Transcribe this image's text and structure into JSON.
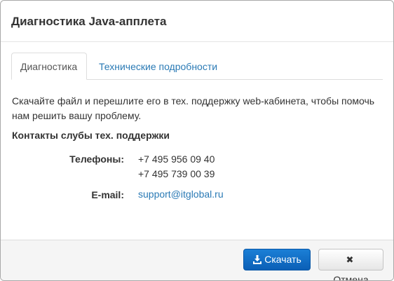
{
  "modal": {
    "title": "Диагностика Java-апплета"
  },
  "tabs": [
    {
      "label": "Диагностика",
      "active": true
    },
    {
      "label": "Технические подробности",
      "active": false
    }
  ],
  "body": {
    "intro": "Скачайте файл и перешлите его в тех. поддержку web-кабинета, чтобы помочь нам решить вашу проблему.",
    "contacts_heading": "Контакты слубы тех. поддержки",
    "phones_label": "Телефоны:",
    "phones": [
      "+7 495 956 09 40",
      "+7 495 739 00 39"
    ],
    "email_label": "E-mail:",
    "email": "support@itglobal.ru"
  },
  "footer": {
    "download_label": "Скачать",
    "download_icon": "download-icon",
    "cancel_label": "Отмена",
    "cancel_icon": "close-icon"
  },
  "colors": {
    "primary": "#0b6ec4",
    "link": "#2a7ab5",
    "footer_bg": "#f5f5f5"
  }
}
